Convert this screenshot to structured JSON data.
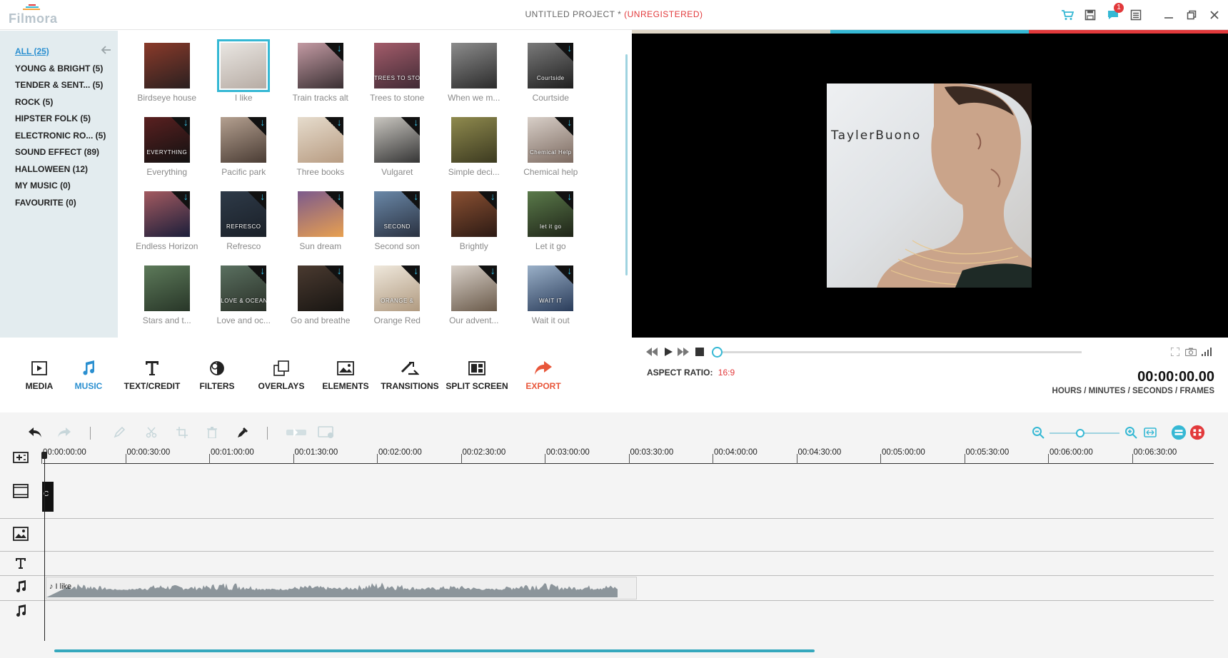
{
  "app": {
    "logo_text": "Filmora",
    "title": "UNTITLED PROJECT *",
    "title_status": "(UNREGISTERED)",
    "notification_count": "1",
    "icons": [
      "cart-icon",
      "save-icon",
      "chat-icon",
      "menu-icon",
      "minimize-icon",
      "restore-icon",
      "close-icon"
    ]
  },
  "categories": [
    {
      "label": "ALL (25)",
      "active": true
    },
    {
      "label": "YOUNG & BRIGHT (5)"
    },
    {
      "label": "TENDER & SENT... (5)"
    },
    {
      "label": "ROCK (5)"
    },
    {
      "label": "HIPSTER FOLK (5)"
    },
    {
      "label": "ELECTRONIC RO... (5)"
    },
    {
      "label": "SOUND EFFECT (89)"
    },
    {
      "label": "HALLOWEEN (12)"
    },
    {
      "label": "MY MUSIC (0)"
    },
    {
      "label": "FAVOURITE (0)"
    }
  ],
  "music": [
    {
      "label": "Birdseye house",
      "caption": "",
      "c1": "#8a3a2a",
      "c2": "#2a2020",
      "download": false
    },
    {
      "label": "I like",
      "caption": "",
      "c1": "#e9e6e2",
      "c2": "#b7aca4",
      "download": false,
      "selected": true
    },
    {
      "label": "Train tracks alt",
      "caption": "",
      "c1": "#c39aa3",
      "c2": "#3a3033",
      "download": true
    },
    {
      "label": "Trees to stone",
      "caption": "TREES TO STONE",
      "c1": "#a35c6a",
      "c2": "#402a35",
      "download": false
    },
    {
      "label": "When we m...",
      "caption": "",
      "c1": "#8c8c8c",
      "c2": "#2b2b2b",
      "download": false
    },
    {
      "label": "Courtside",
      "caption": "Courtside",
      "c1": "#7a7a7a",
      "c2": "#1f1f1f",
      "download": true
    },
    {
      "label": "Everything",
      "caption": "EVERYTHING",
      "c1": "#5a2020",
      "c2": "#111111",
      "download": true
    },
    {
      "label": "Pacific park",
      "caption": "",
      "c1": "#b4a090",
      "c2": "#4a3c34",
      "download": true
    },
    {
      "label": "Three books",
      "caption": "",
      "c1": "#e6dccd",
      "c2": "#b89c82",
      "download": true
    },
    {
      "label": "Vulgaret",
      "caption": "",
      "c1": "#c9c6c0",
      "c2": "#353535",
      "download": true
    },
    {
      "label": "Simple deci...",
      "caption": "",
      "c1": "#8f8a4e",
      "c2": "#3c3a20",
      "download": false
    },
    {
      "label": "Chemical help",
      "caption": "Chemical Help",
      "c1": "#d8cfc8",
      "c2": "#7c6a60",
      "download": true
    },
    {
      "label": "Endless Horizon",
      "caption": "",
      "c1": "#a35a60",
      "c2": "#1b1e3a",
      "download": true
    },
    {
      "label": "Refresco",
      "caption": "REFRESCO",
      "c1": "#2e3a48",
      "c2": "#1a2028",
      "download": true
    },
    {
      "label": "Sun dream",
      "caption": "",
      "c1": "#7c5a8c",
      "c2": "#e8a050",
      "download": true
    },
    {
      "label": "Second son",
      "caption": "SECOND",
      "c1": "#6a88a8",
      "c2": "#2a3140",
      "download": true
    },
    {
      "label": "Brightly",
      "caption": "",
      "c1": "#8a5032",
      "c2": "#2c1a14",
      "download": true
    },
    {
      "label": "Let it go",
      "caption": "let it go",
      "c1": "#5a7a4a",
      "c2": "#1f2418",
      "download": true
    },
    {
      "label": "Stars and t...",
      "caption": "",
      "c1": "#5d7a5a",
      "c2": "#283628",
      "download": false
    },
    {
      "label": "Love and oc...",
      "caption": "LOVE & OCEAN",
      "c1": "#5a7060",
      "c2": "#2a3028",
      "download": true
    },
    {
      "label": "Go and breathe",
      "caption": "",
      "c1": "#4a3a30",
      "c2": "#181512",
      "download": true
    },
    {
      "label": "Orange Red",
      "caption": "ORANGE &",
      "c1": "#efe8dc",
      "c2": "#b09a80",
      "download": true
    },
    {
      "label": "Our advent...",
      "caption": "",
      "c1": "#d8d0c8",
      "c2": "#6a5a4a",
      "download": true
    },
    {
      "label": "Wait it out",
      "caption": "WAIT IT",
      "c1": "#9ab0c8",
      "c2": "#2a3c5a",
      "download": true
    }
  ],
  "preview": {
    "artist_text": "TaylerBuono"
  },
  "playback": {
    "aspect_label": "ASPECT RATIO:",
    "aspect_value": "16:9",
    "timecode": "00:00:00.00",
    "timecode_label": "HOURS / MINUTES / SECONDS / FRAMES",
    "progress": 0.0
  },
  "tabs": [
    {
      "label": "MEDIA",
      "icon": "media-icon"
    },
    {
      "label": "MUSIC",
      "icon": "music-icon",
      "active": true
    },
    {
      "label": "TEXT/CREDIT",
      "icon": "text-icon"
    },
    {
      "label": "FILTERS",
      "icon": "filters-icon"
    },
    {
      "label": "OVERLAYS",
      "icon": "overlays-icon"
    },
    {
      "label": "ELEMENTS",
      "icon": "elements-icon"
    },
    {
      "label": "TRANSITIONS",
      "icon": "transitions-icon"
    },
    {
      "label": "SPLIT SCREEN",
      "icon": "split-screen-icon"
    },
    {
      "label": "EXPORT",
      "icon": "export-icon"
    }
  ],
  "timeline": {
    "ticks": [
      "00:00:00:00",
      "00:00:30:00",
      "00:01:00:00",
      "00:01:30:00",
      "00:02:00:00",
      "00:02:30:00",
      "00:03:00:00",
      "00:03:30:00",
      "00:04:00:00",
      "00:04:30:00",
      "00:05:00:00",
      "00:05:30:00",
      "00:06:00:00",
      "00:06:30:00"
    ],
    "video_clip_label": "C",
    "audio_clip_label": "♪ I like",
    "zoom_level": 0.4
  },
  "colors": {
    "accent": "#35b8d4",
    "active_text": "#2a8fd0",
    "warning": "#e2393b",
    "export": "#e8563a",
    "strip_beige": "#ded6c6",
    "strip_teal": "#35b8d4",
    "strip_red": "#e2393b"
  }
}
